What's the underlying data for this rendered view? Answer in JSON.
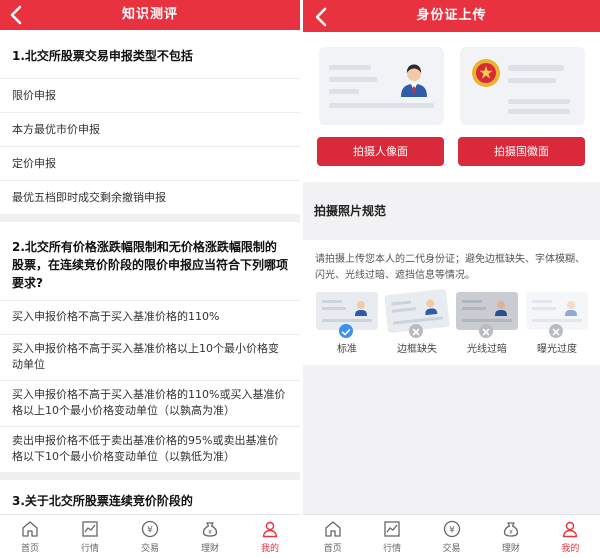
{
  "left": {
    "title": "知识测评",
    "questions": [
      {
        "title": "1.北交所股票交易申报类型不包括",
        "options": [
          "限价申报",
          "本方最优市价申报",
          "定价申报",
          "最优五档即时成交剩余撤销申报"
        ]
      },
      {
        "title": "2.北交所有价格涨跌幅限制和无价格涨跌幅限制的股票，在连续竞价阶段的限价申报应当符合下列哪项要求?",
        "options": [
          "买入申报价格不高于买入基准价格的110%",
          "买入申报价格不高于买入基准价格以上10个最小价格变动单位",
          "买入申报价格不高于买入基准价格的110%或买入基准价格以上10个最小价格变动单位（以孰高为准）",
          "卖出申报价格不低于卖出基准价格的95%或卖出基准价格以下10个最小价格变动单位（以孰低为准）"
        ]
      },
      {
        "title": "3.关于北交所股票连续竞价阶段的",
        "options": []
      }
    ]
  },
  "right": {
    "title": "身份证上传",
    "photo_front_button": "拍摄人像面",
    "photo_back_button": "拍摄国徽面",
    "rules_title": "拍摄照片规范",
    "rules_text": "请拍摄上传您本人的二代身份证；避免边框缺失、字体模糊、闪光、光线过暗、遮挡信息等情况。",
    "samples": [
      {
        "label": "标准",
        "status": "ok"
      },
      {
        "label": "边框缺失",
        "status": "bad"
      },
      {
        "label": "光线过暗",
        "status": "bad"
      },
      {
        "label": "曝光过度",
        "status": "bad"
      }
    ]
  },
  "tabbar": {
    "items": [
      {
        "label": "首页",
        "icon": "home-icon"
      },
      {
        "label": "行情",
        "icon": "chart-icon"
      },
      {
        "label": "交易",
        "icon": "yuan-icon"
      },
      {
        "label": "理财",
        "icon": "money-bag-icon"
      },
      {
        "label": "我的",
        "icon": "person-icon"
      }
    ],
    "active": 4
  },
  "colors": {
    "brand_red": "#e8323f",
    "button_red": "#d9293a",
    "check_blue": "#3d8ff0"
  }
}
